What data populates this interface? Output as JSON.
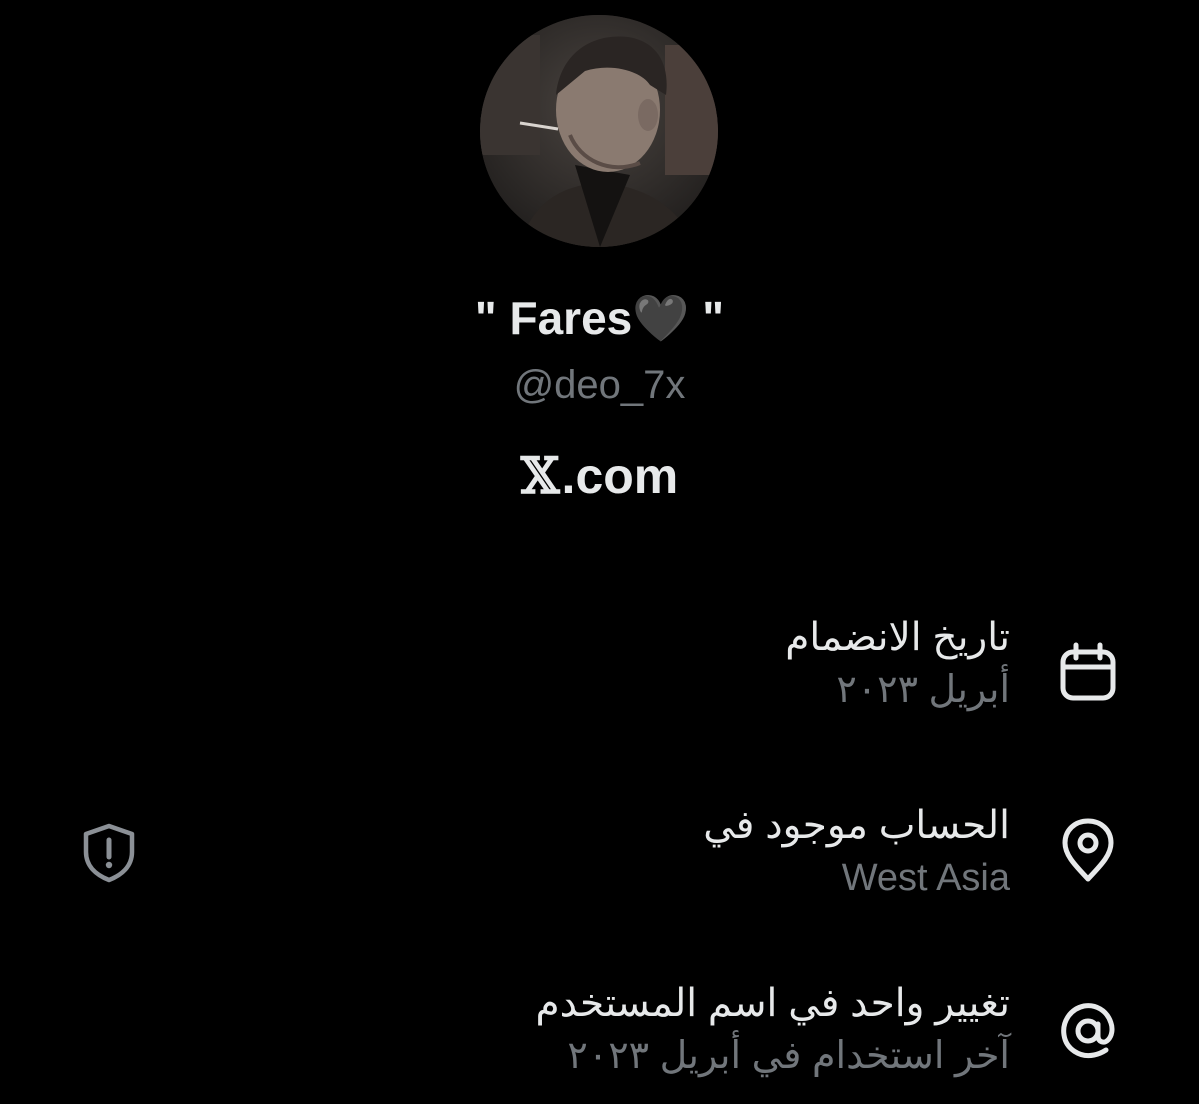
{
  "profile": {
    "display_name": "\" Fares🖤 \"",
    "handle": "@deo_7x",
    "avatar_icon": "avatar-photo"
  },
  "site": {
    "glyph": "𝕏",
    "suffix": ".com"
  },
  "about": {
    "joined": {
      "title": "تاريخ الانضمام",
      "value": "أبريل ٢٠٢٣",
      "icon": "calendar-icon"
    },
    "location": {
      "title": "الحساب موجود في",
      "value": "West Asia",
      "icon": "location-pin-icon",
      "badge_icon": "shield-alert-icon"
    },
    "username_changes": {
      "title": "تغيير واحد في اسم المستخدم",
      "value": "آخر استخدام في أبريل ٢٠٢٣",
      "icon": "at-sign-icon"
    }
  },
  "colors": {
    "background": "#000000",
    "primary_text": "#e7e9ea",
    "secondary_text": "#71767b"
  }
}
